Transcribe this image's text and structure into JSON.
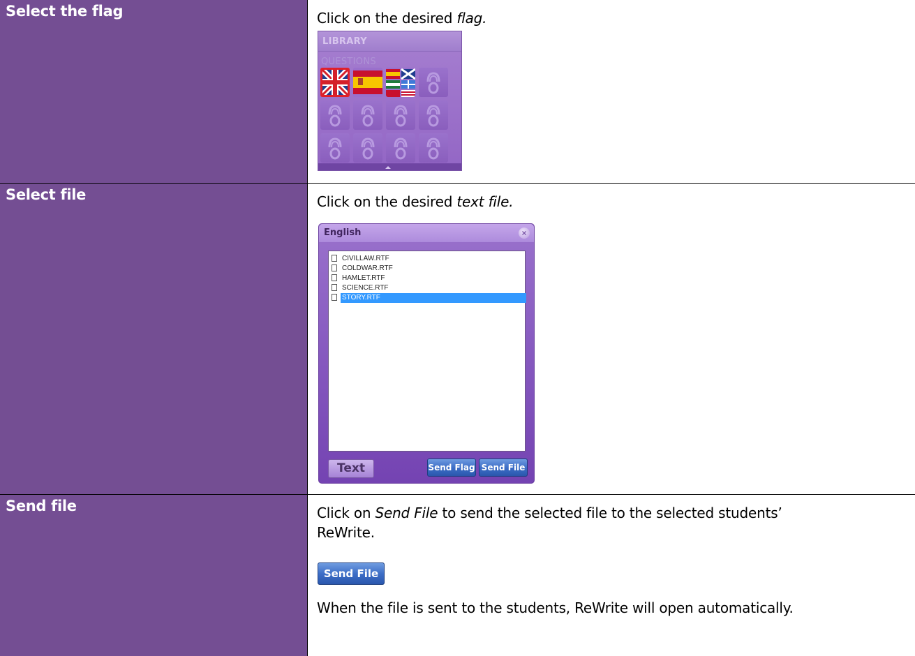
{
  "rows": [
    {
      "title": "Select the flag",
      "desc_prefix": "Click on the desired ",
      "desc_em": "flag."
    },
    {
      "title": "Select file",
      "desc_prefix": "Click on the desired ",
      "desc_em": "text file."
    },
    {
      "title": "Send file",
      "desc_line1_prefix": "Click on ",
      "desc_line1_em": "Send File",
      "desc_line1_suffix": " to send the selected file to the selected students’",
      "desc_line2": "ReWrite.",
      "desc_line3": "When the file is sent to the students, ReWrite will open automatically."
    }
  ],
  "library": {
    "title": "LIBRARY",
    "subtitle": "QUESTIONS",
    "flag_tiles": [
      "united-kingdom-flag",
      "spain-flag",
      "mixed-flags"
    ],
    "selected_tile": "united-kingdom-flag",
    "locked_icon": "padlock-icon"
  },
  "dialog": {
    "title": "English",
    "close_icon": "close-icon",
    "files": [
      "CIVILLAW.RTF",
      "COLDWAR.RTF",
      "HAMLET.RTF",
      "SCIENCE.RTF",
      "STORY.RTF"
    ],
    "selected_file": "STORY.RTF",
    "text_button": "Text",
    "send_flag_button": "Send Flag",
    "send_file_button": "Send File"
  },
  "send_file_button": "Send File",
  "colors": {
    "left_cell": "#744e93",
    "selection": "#3399ff",
    "selected_flag_border": "#e0202a"
  }
}
